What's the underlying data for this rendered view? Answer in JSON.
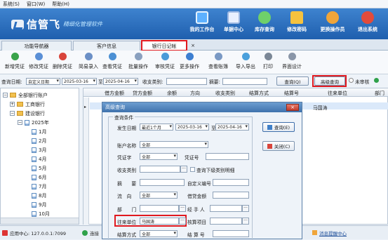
{
  "menu": [
    "系统(S)",
    "窗口(W)",
    "帮助(H)"
  ],
  "app": {
    "name": "信管飞",
    "slogan": "精细化管理软件"
  },
  "topnav": [
    {
      "label": "我的工作台",
      "icon": "desk-icon",
      "color": "#5db1ff"
    },
    {
      "label": "单据中心",
      "icon": "document-center-icon",
      "color": "#e9f0ff"
    },
    {
      "label": "库存查询",
      "icon": "inventory-icon",
      "color": "#6fd06a"
    },
    {
      "label": "修改密码",
      "icon": "lock-icon",
      "color": "#f6c23e"
    },
    {
      "label": "更换操作员",
      "icon": "users-icon",
      "color": "#f0a53a"
    },
    {
      "label": "退出系统",
      "icon": "exit-icon",
      "color": "#e24b3b"
    }
  ],
  "tabs": [
    "功能导航器",
    "客户信息",
    "银行日记帐"
  ],
  "tab_close": "×",
  "toolbar": [
    {
      "label": "新增凭证",
      "icon": "add-icon",
      "color": "#3aa34a"
    },
    {
      "label": "修改凭证",
      "icon": "edit-icon",
      "color": "#5a8fd6"
    },
    {
      "label": "删除凭证",
      "icon": "delete-icon",
      "color": "#d9453b"
    },
    {
      "label": "简易录入",
      "icon": "quick-entry-icon",
      "color": "#6b8fc6"
    },
    {
      "label": "查看凭证",
      "icon": "view-icon",
      "color": "#4c90d4"
    },
    {
      "label": "批量操作",
      "icon": "batch-icon",
      "color": "#8aa0bf"
    },
    {
      "label": "审核凭证",
      "icon": "approve-icon",
      "color": "#4a9ad8"
    },
    {
      "label": "更多操作",
      "icon": "more-icon",
      "color": "#3d7fd1"
    },
    {
      "label": "查看账簿",
      "icon": "ledger-icon",
      "color": "#7a99c4"
    },
    {
      "label": "导入导出",
      "icon": "import-export-icon",
      "color": "#4aa0dc"
    },
    {
      "label": "打印",
      "icon": "print-icon",
      "color": "#7b8796"
    },
    {
      "label": "界面设计",
      "icon": "design-icon",
      "color": "#8a96a8"
    }
  ],
  "filter": {
    "date_label": "查询日期:",
    "date_mode": "自定义日期",
    "date_from": "2025-03-16",
    "to": "至",
    "date_to": "2025-04-16",
    "category_label": "收支类别:",
    "category_value": "",
    "summary_label": "摘要:",
    "summary_value": "",
    "query_btn": "查询(Q)",
    "adv_btn": "高级查询",
    "unreviewed": "未审核"
  },
  "tree": {
    "root": "全部银行账户",
    "items": [
      "工商银行",
      "建设银行",
      "2025年",
      "1月",
      "2月",
      "3月",
      "4月",
      "5月",
      "6月",
      "7月",
      "8月",
      "9月",
      "10月"
    ]
  },
  "grid": {
    "headers": [
      "借方金额",
      "贷方金额",
      "余额",
      "方向",
      "收支类别",
      "结算方式",
      "结算号",
      "往来单位",
      "部门"
    ],
    "row": {
      "partner": "马国涛"
    }
  },
  "status": {
    "server": "应用中心: 127.0.0.1:7099",
    "conn": "连接",
    "msg": "消息提醒中心"
  },
  "dialog": {
    "title": "高级查询",
    "close": "×",
    "group": "查询条件",
    "date_label": "发生日期",
    "date_mode": "最近1个月",
    "date_from": "2025-03-16",
    "to": "至",
    "date_to": "2025-04-16",
    "account_label": "账户名称",
    "account_value": "全部",
    "voucher_label": "凭证字",
    "voucher_value": "全部",
    "voucher_no_label": "凭证号",
    "category_label": "收支类别",
    "sub_label": "查询下级类别明细",
    "summary_label": "摘　　要",
    "custom_label": "自定义编号",
    "flow_label": "流　向",
    "flow_value": "全部",
    "amount_label": "借贷金额",
    "dept_label": "部　　门",
    "handler_label": "经 手 人",
    "partner_label": "往来单位",
    "partner_value": "马国涛",
    "project_label": "核算项目",
    "settle_label": "结算方式",
    "settle_value": "全部",
    "settle_no_label": "结 算 号",
    "query_btn": "查询(E)",
    "close_btn": "关闭(C)"
  }
}
